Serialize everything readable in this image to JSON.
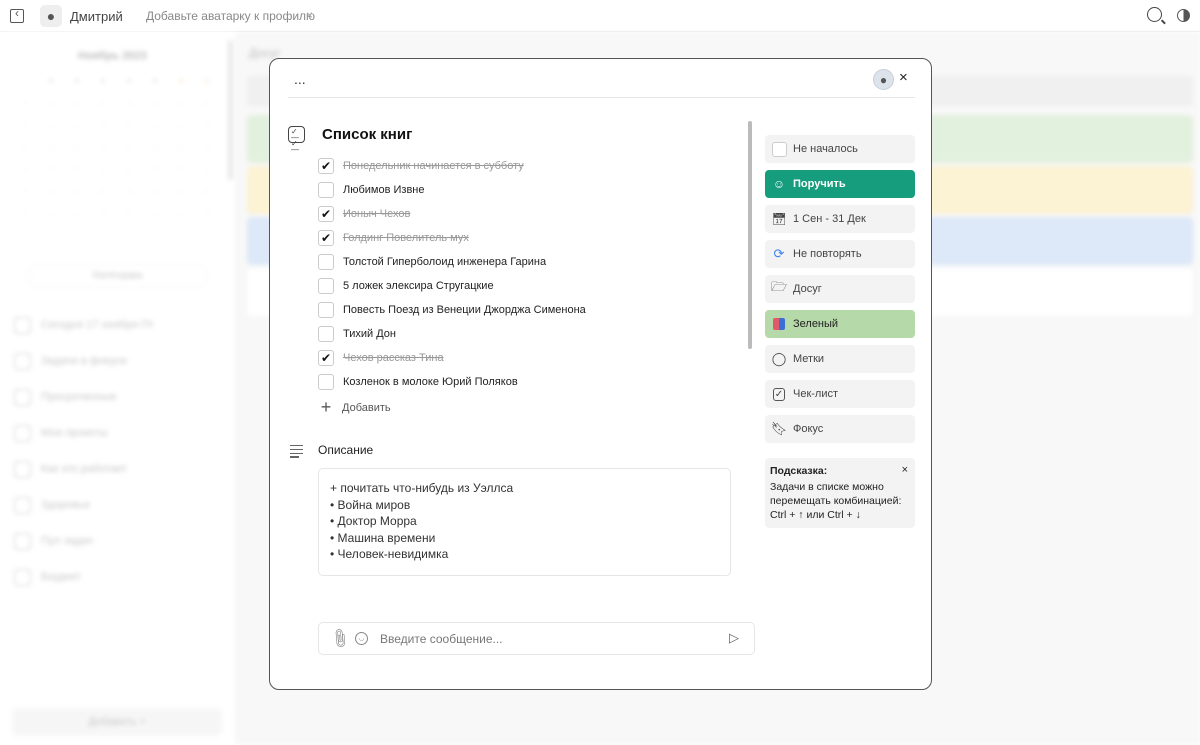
{
  "topbar": {
    "user_name": "Дмитрий",
    "avatar_hint": "Добавьте аватарку к профилю",
    "hint_close": "×"
  },
  "background": {
    "calendar_title": "Ноябрь 2023",
    "calendar_button": "Календарь",
    "sidebar_items": [
      "Сегодня 17 ноября Пт",
      "Задачи в фокусе",
      "Просроченные",
      "Мои проекты",
      "Как это работает",
      "Здоровье",
      "Пул задач",
      "Бюджет"
    ],
    "add_button": "Добавить +",
    "main_title": "Досуг",
    "card_colors": [
      "#d3e8cc",
      "#fbebbd",
      "#cbdcf5",
      "#ffffff"
    ]
  },
  "modal": {
    "menu": "...",
    "close": "×",
    "checklist": {
      "title": "Список книг",
      "items": [
        {
          "text": "Понедельник начинается в субботу",
          "done": true
        },
        {
          "text": "Любимов Извне",
          "done": false
        },
        {
          "text": "Ионыч Чехов",
          "done": true
        },
        {
          "text": "Голдинг Повелитель мух",
          "done": true
        },
        {
          "text": "Толстой Гиперболоид инженера Гарина",
          "done": false
        },
        {
          "text": "5 ложек элексира Стругацкие",
          "done": false
        },
        {
          "text": "Повесть Поезд из Венеции Джорджа Сименона",
          "done": false
        },
        {
          "text": "Тихий Дон",
          "done": false
        },
        {
          "text": "Чехов рассказ Тина",
          "done": true
        },
        {
          "text": "Козленок в молоке Юрий Поляков",
          "done": false
        }
      ],
      "add_label": "Добавить"
    },
    "description": {
      "label": "Описание",
      "lines": [
        "+ почитать что-нибудь из Уэллса",
        "• Война миров",
        "• Доктор Морра",
        "• Машина времени",
        "• Человек-невидимка"
      ]
    },
    "message": {
      "placeholder": "Введите сообщение..."
    },
    "side_panel": {
      "buttons": [
        {
          "label": "Не началось",
          "icon": "status-checkbox-icon"
        },
        {
          "label": "Поручить",
          "icon": "user-icon"
        },
        {
          "label": "1 Сен - 31 Дек",
          "icon": "calendar-icon"
        },
        {
          "label": "Не повторять",
          "icon": "repeat-icon"
        },
        {
          "label": "Досуг",
          "icon": "folder-icon"
        },
        {
          "label": "Зеленый",
          "icon": "color-palette-icon"
        },
        {
          "label": "Метки",
          "icon": "tag-icon"
        },
        {
          "label": "Чек-лист",
          "icon": "checklist-icon"
        },
        {
          "label": "Фокус",
          "icon": "bookmark-icon"
        }
      ],
      "hint": {
        "title": "Подсказка:",
        "text": "Задачи в списке можно перемещать комбинацией: Ctrl + ↑ или Ctrl + ↓",
        "close": "×"
      }
    },
    "colors": {
      "assign": "#159d7e",
      "green_tag": "#b6d9a9"
    }
  }
}
